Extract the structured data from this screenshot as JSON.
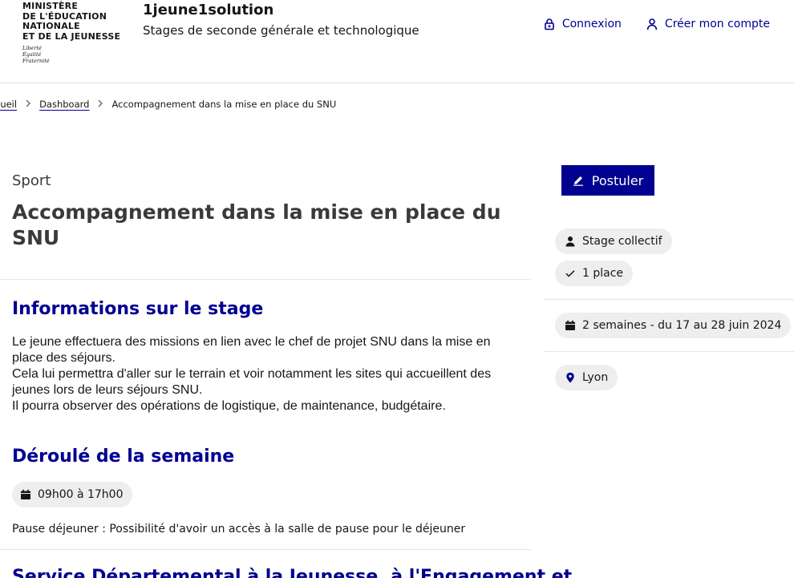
{
  "header": {
    "ministry_lines": [
      "MINISTÈRE",
      "DE L'ÉDUCATION",
      "NATIONALE",
      "ET DE LA JEUNESSE"
    ],
    "devise_lines": [
      "Liberté",
      "Égalité",
      "Fraternité"
    ],
    "service_title": "1jeune1solution",
    "service_tagline": "Stages de seconde générale et technologique",
    "tools": {
      "login_label": "Connexion",
      "login_icon": "lock-icon",
      "signup_label": "Créer mon compte",
      "signup_icon": "user-icon"
    }
  },
  "breadcrumb": {
    "home_label": "cueil",
    "dashboard_label": "Dashboard",
    "current_label": "Accompagnement dans la mise en place du SNU"
  },
  "offer": {
    "category": "Sport",
    "title": "Accompagnement dans la mise en place du SNU",
    "info_heading": "Informations sur le stage",
    "description": [
      "Le jeune effectuera des missions en lien avec le chef de projet SNU dans la mise en place des séjours.",
      "Cela lui permettra d'aller sur le terrain et voir notamment les sites qui accueillent des jeunes lors de leurs séjours SNU.",
      "Il pourra observer des opérations de logistique, de maintenance, budgétaire."
    ],
    "week_heading": "Déroulé de la semaine",
    "hours": "09h00 à 17h00",
    "pause": "Pause déjeuner : Possibilité d'avoir un accès à la salle de pause pour le déjeuner",
    "next_heading": "Service Départemental à la Jeunesse, à l'Engagement et"
  },
  "sidebar": {
    "apply_label": "Postuler",
    "internship_type": "Stage collectif",
    "places": "1 place",
    "period": "2 semaines - du 17 au 28 juin 2024",
    "city": "Lyon"
  },
  "colors": {
    "primary": "#000091",
    "chip_bg": "#eeeeee",
    "divider": "#e5e5e5"
  }
}
